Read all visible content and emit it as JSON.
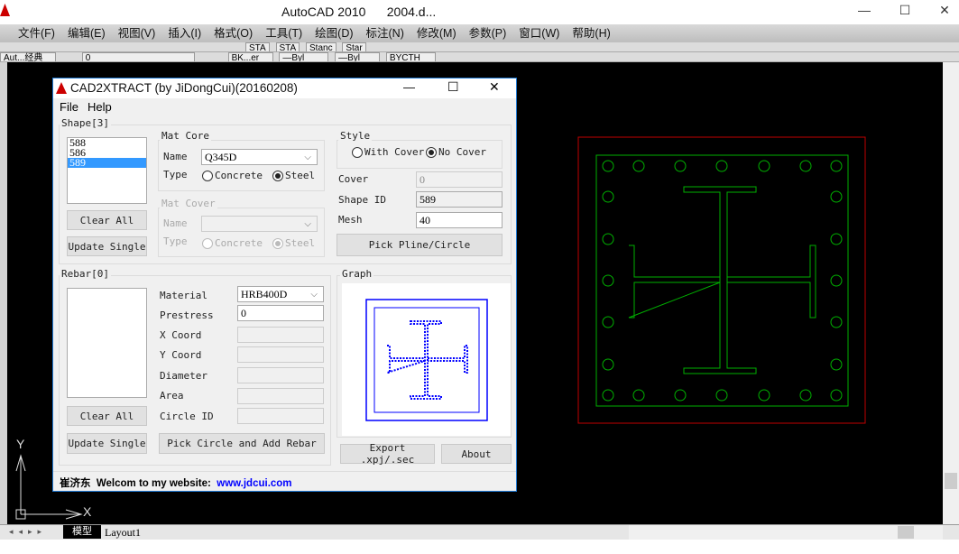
{
  "app": {
    "title": "AutoCAD 2010",
    "document": "2004.d...",
    "minimize": "—",
    "maximize": "☐",
    "close": "✕"
  },
  "menu": [
    "文件(F)",
    "编辑(E)",
    "视图(V)",
    "插入(I)",
    "格式(O)",
    "工具(T)",
    "绘图(D)",
    "标注(N)",
    "修改(M)",
    "参数(P)",
    "窗口(W)",
    "帮助(H)"
  ],
  "toolbar1": {
    "styles": [
      "STA",
      "STA",
      "Stanc",
      "Star"
    ]
  },
  "toolbar2": {
    "workspace": "Aut...经典",
    "layer": "0",
    "color": "BK...er",
    "linetype": "—Byl",
    "lineweight": "—Byl",
    "plot": "BYCTH"
  },
  "layout_tabs": {
    "model": "模型",
    "layout1": "Layout1"
  },
  "ucs": {
    "x": "X",
    "y": "Y"
  },
  "dialog": {
    "title": "CAD2XTRACT (by JiDongCui)(20160208)",
    "menu": [
      "File",
      "Help"
    ],
    "shape": {
      "label": "Shape[3]",
      "items": [
        "588",
        "586",
        "589"
      ],
      "selected": "589",
      "clear": "Clear All",
      "update": "Update Single"
    },
    "mat_core": {
      "label": "Mat Core",
      "name_label": "Name",
      "name": "Q345D",
      "type_label": "Type",
      "concrete": "Concrete",
      "steel": "Steel",
      "selected": "Steel"
    },
    "mat_cover": {
      "label": "Mat Cover",
      "name_label": "Name",
      "name": "",
      "type_label": "Type",
      "concrete": "Concrete",
      "steel": "Steel",
      "selected": "Steel"
    },
    "style": {
      "label": "Style",
      "with_cover": "With Cover",
      "no_cover": "No Cover",
      "selected": "No Cover"
    },
    "cover_label": "Cover",
    "cover": "0",
    "shape_id_label": "Shape ID",
    "shape_id": "589",
    "mesh_label": "Mesh",
    "mesh": "40",
    "pick_pline": "Pick Pline/Circle",
    "rebar": {
      "label": "Rebar[0]",
      "clear": "Clear All",
      "update": "Update Single",
      "material_label": "Material",
      "material": "HRB400D",
      "prestress_label": "Prestress",
      "prestress": "0",
      "x_label": "X Coord",
      "y_label": "Y Coord",
      "diameter_label": "Diameter",
      "area_label": "Area",
      "circle_id_label": "Circle ID",
      "pick": "Pick Circle and Add Rebar"
    },
    "graph_label": "Graph",
    "export": "Export .xpj/.sec",
    "about": "About",
    "footer_name": "崔济东",
    "footer_text": "Welcom to my website:",
    "footer_link": "www.jdcui.com",
    "colors": {
      "link": "#0000ff",
      "graph": "#0000ff",
      "cad_outer": "#ff0000",
      "cad_green": "#00c000"
    }
  }
}
